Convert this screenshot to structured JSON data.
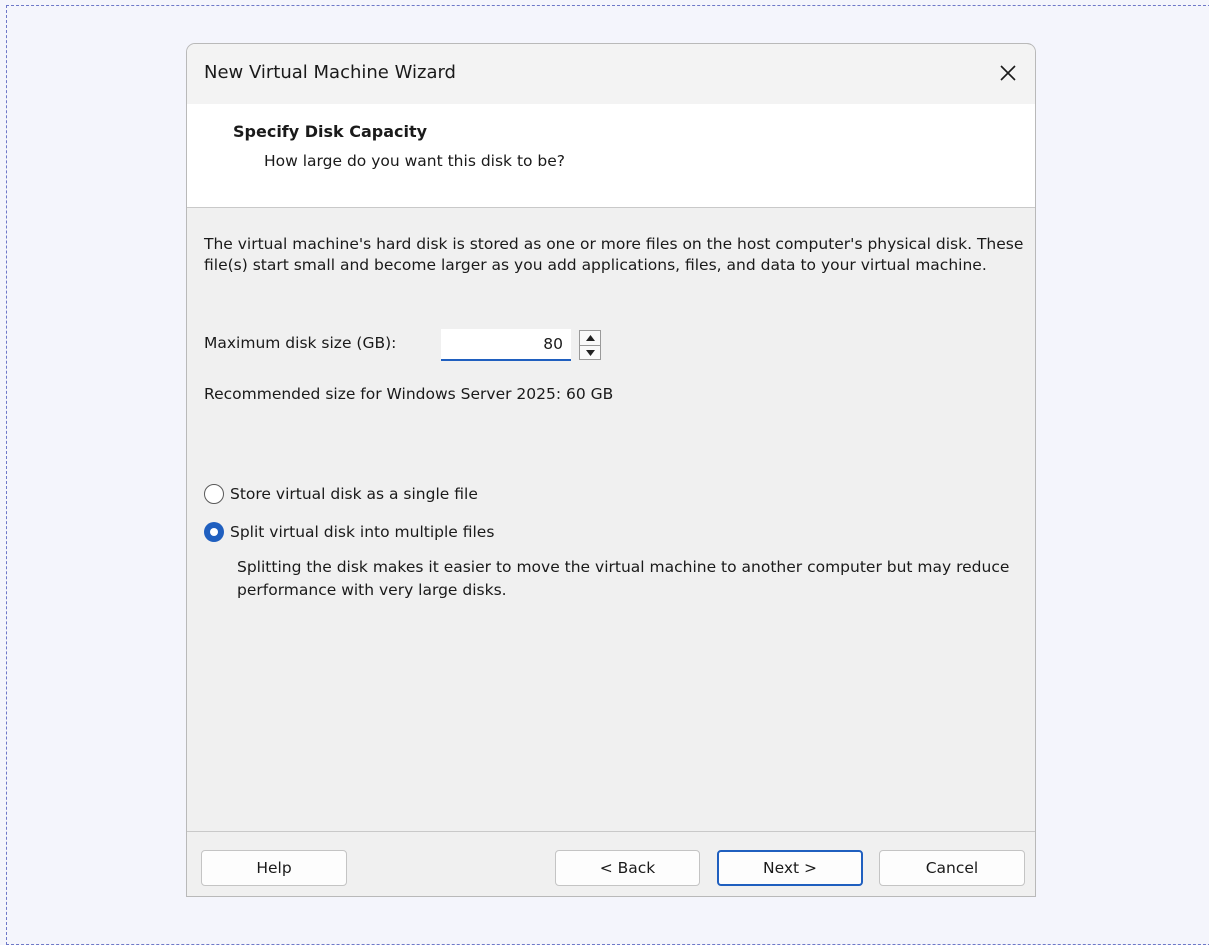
{
  "window": {
    "title": "New Virtual Machine Wizard"
  },
  "header": {
    "title": "Specify Disk Capacity",
    "subtitle": "How large do you want this disk to be?"
  },
  "content": {
    "description": "The virtual machine's hard disk is stored as one or more files on the host computer's physical disk. These file(s) start small and become larger as you add applications, files, and data to your virtual machine.",
    "disk_size_label": "Maximum disk size (GB):",
    "disk_size_value": "80",
    "recommended_text": "Recommended size for Windows Server 2025: 60 GB",
    "options": [
      {
        "label": "Store virtual disk as a single file",
        "selected": false
      },
      {
        "label": "Split virtual disk into multiple files",
        "selected": true
      }
    ],
    "split_note": "Splitting the disk makes it easier to move the virtual machine to another computer but may reduce performance with very large disks."
  },
  "footer": {
    "help_label": "Help",
    "back_label": "< Back",
    "next_label": "Next >",
    "cancel_label": "Cancel"
  },
  "colors": {
    "accent": "#1f5fbf",
    "dialog_bg": "#f0f0f0",
    "header_bg": "#ffffff"
  },
  "icons": {
    "close": "close-icon",
    "spin_up": "chevron-up-icon",
    "spin_down": "chevron-down-icon"
  }
}
